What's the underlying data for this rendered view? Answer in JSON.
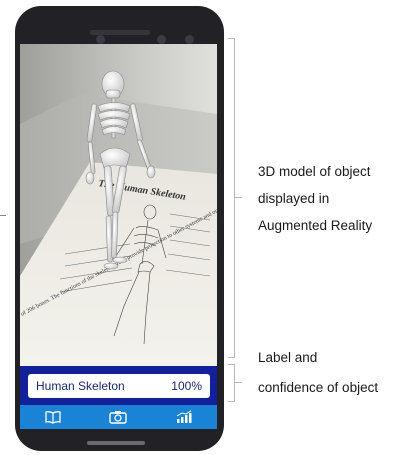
{
  "app": {
    "label_text": "Human Skeleton",
    "confidence_text": "100%",
    "page_title": "The Human Skeleton",
    "page_caption": "of 206 bones. The functions of the skeleton are ... provide protection to other systems and organs ... produce movement and to produce",
    "nav": [
      {
        "name": "book",
        "icon": "book-icon"
      },
      {
        "name": "camera",
        "icon": "camera-icon"
      },
      {
        "name": "chart",
        "icon": "chart-icon"
      }
    ],
    "colors": {
      "phone": "#222226",
      "label_band": "#12209a",
      "nav_bar": "#1a83d6",
      "button_accent": "#e36a42"
    }
  },
  "annotations": [
    {
      "lines": [
        "3D model of object",
        "displayed in",
        "Augmented Reality"
      ]
    },
    {
      "lines": [
        "Label and",
        "confidence of object"
      ]
    }
  ]
}
